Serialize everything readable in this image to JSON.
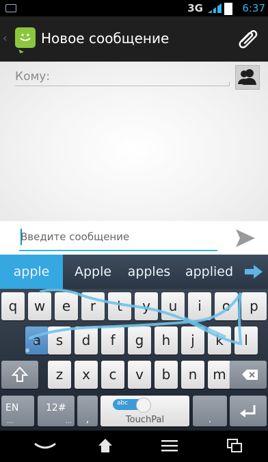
{
  "status_bar": {
    "network": "3G",
    "time": "6:37",
    "time_color": "#33b5e5"
  },
  "action_bar": {
    "title": "Новое сообщение",
    "icons": [
      "back-caret-icon",
      "messaging-app-icon",
      "paperclip-icon"
    ],
    "app_icon_color": "#8cc63e"
  },
  "recipient": {
    "label": "Кому:",
    "contacts_icon": "contacts-icon"
  },
  "compose": {
    "placeholder": "Введите сообщение",
    "send_icon": "send-icon",
    "accent_color": "#33b5e5"
  },
  "suggestions": {
    "items": [
      "apple",
      "Apple",
      "apples",
      "applied"
    ],
    "selected_index": 0,
    "more_icon": "arrow-right-icon",
    "selected_color": "#35a7e1"
  },
  "keyboard": {
    "row1": [
      "q",
      "w",
      "e",
      "r",
      "t",
      "y",
      "u",
      "i",
      "o",
      "p"
    ],
    "row2": [
      "a",
      "s",
      "d",
      "f",
      "g",
      "h",
      "j",
      "k",
      "l"
    ],
    "row3": [
      "z",
      "x",
      "c",
      "v",
      "b",
      "n",
      "m"
    ],
    "shift_icon": "shift-arrow-icon",
    "delete_icon": "backspace-icon",
    "lang_key": "EN",
    "lang_hint": "...",
    "symbols_key": "12#",
    "symbols_hint": "...",
    "comma": ",",
    "space_toggle": "abc",
    "space_brand": "TouchPal",
    "period": ".",
    "enter_icon": "enter-icon",
    "swipe_trail_color": "#6fc3ea"
  },
  "nav_bar": {
    "icons": [
      "hide-keyboard-icon",
      "home-icon",
      "menu-icon",
      "recent-apps-icon"
    ]
  }
}
